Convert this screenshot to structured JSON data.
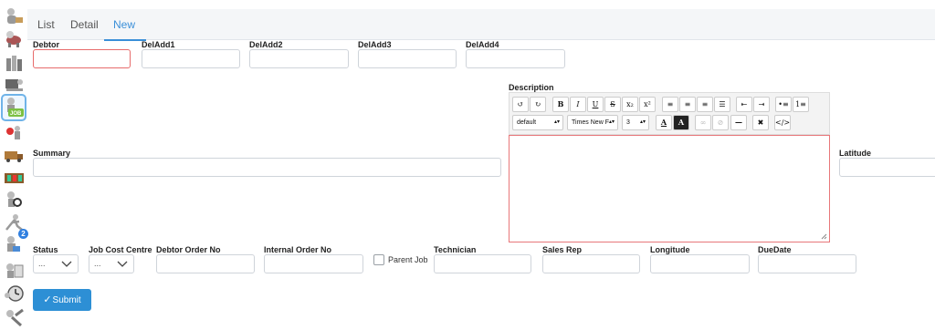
{
  "tabs": [
    {
      "label": "List"
    },
    {
      "label": "Detail"
    },
    {
      "label": "New"
    }
  ],
  "active_tab": "New",
  "rail_icons": [
    "user-icon",
    "dog-icon",
    "building-icon",
    "worker-icon",
    "jobs-icon",
    "meeting-icon",
    "truck-icon",
    "stock-icon",
    "search-person-icon",
    "runner-icon",
    "notify-icon",
    "report-icon",
    "clock-icon",
    "tools-icon"
  ],
  "badge_count": "2",
  "fields": {
    "debtor": "Debtor",
    "deladd1": "DelAdd1",
    "deladd2": "DelAdd2",
    "deladd3": "DelAdd3",
    "deladd4": "DelAdd4",
    "description": "Description",
    "summary": "Summary",
    "latitude": "Latitude",
    "status": "Status",
    "job_cost_centre": "Job Cost Centre",
    "debtor_order_no": "Debtor Order No",
    "internal_order_no": "Internal Order No",
    "parent_job": "Parent Job",
    "technician": "Technician",
    "sales_rep": "Sales Rep",
    "longitude": "Longitude",
    "duedate": "DueDate"
  },
  "selects": {
    "status_value": "...",
    "job_cost_centre_value": "..."
  },
  "editor": {
    "style_value": "default",
    "font_value": "Times New F",
    "size_value": "3",
    "buttons": [
      "undo",
      "redo",
      "bold",
      "italic",
      "underline",
      "strikethrough",
      "subscript",
      "superscript",
      "align-left",
      "align-center",
      "align-right",
      "justify",
      "outdent",
      "indent",
      "unordered-list",
      "ordered-list",
      "font-color",
      "highlight",
      "link",
      "unlink",
      "horizontal-rule",
      "remove-format",
      "source-code"
    ]
  },
  "submit_label": "Submit",
  "colors": {
    "accent": "#2d8fd5",
    "error_border": "#e76b6b",
    "tab_active": "#3a8fd8"
  }
}
